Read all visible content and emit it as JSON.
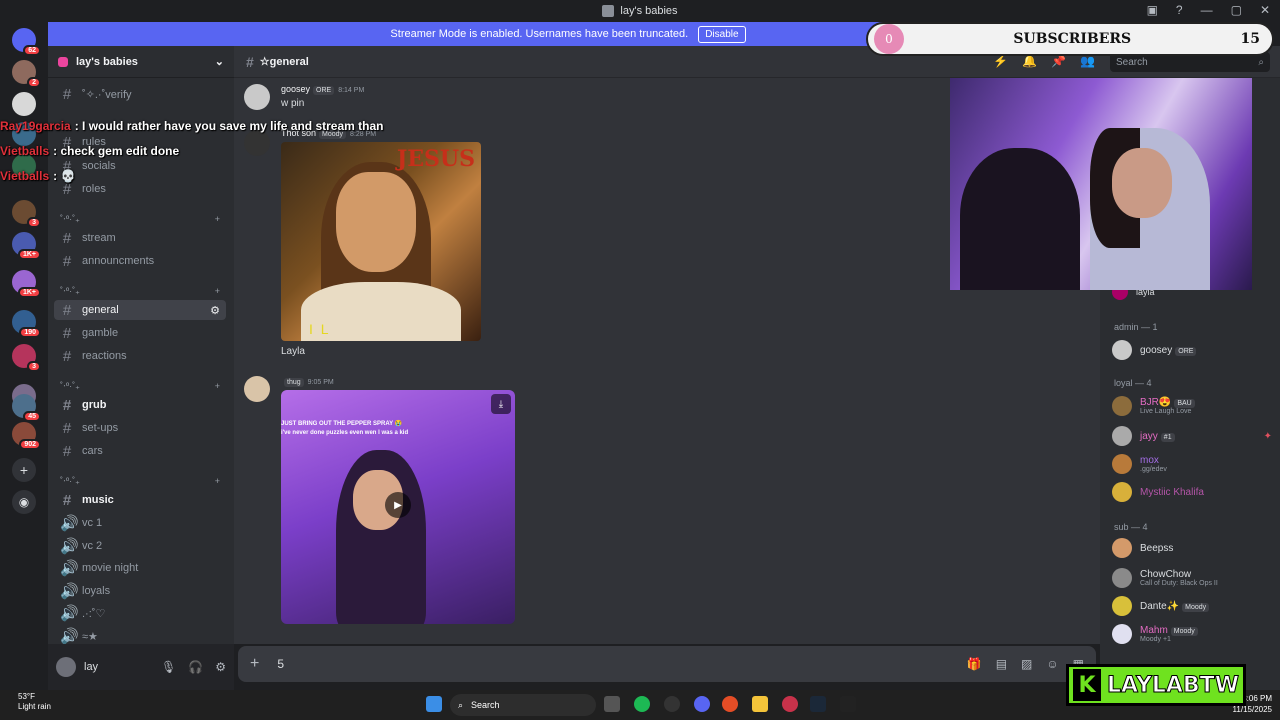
{
  "window": {
    "title": "lay's babies"
  },
  "banner": {
    "text": "Streamer Mode is enabled. Usernames have been truncated.",
    "button": "Disable"
  },
  "server_badges": [
    "62",
    "2",
    "3",
    "1K+",
    "1K+",
    "190",
    "3",
    "45",
    "902"
  ],
  "server": {
    "name": "lay's babies"
  },
  "channels": [
    {
      "label": "˚✧.·˚verify"
    },
    {
      "label": "rules"
    },
    {
      "label": "socials"
    },
    {
      "label": "roles"
    },
    {
      "label": "stream"
    },
    {
      "label": "announcments"
    },
    {
      "label": "general"
    },
    {
      "label": "gamble"
    },
    {
      "label": "reactions"
    },
    {
      "label": "grub"
    },
    {
      "label": "set-ups"
    },
    {
      "label": "cars"
    },
    {
      "label": "music"
    },
    {
      "label": "vc 1"
    },
    {
      "label": "vc 2"
    },
    {
      "label": "movie night"
    },
    {
      "label": "loyals"
    },
    {
      "label": ".·:˚♡"
    },
    {
      "label": "≈★"
    }
  ],
  "categories": [
    "˚‧º·˚₊",
    "˚‧º·˚₊",
    "˚‧º·˚₊",
    "˚‧º·˚₊"
  ],
  "user": {
    "name": "lay"
  },
  "chat_header": {
    "channel": "☆general",
    "search_placeholder": "Search"
  },
  "messages": [
    {
      "author": "goosey",
      "tag": "ORE",
      "time": "8:14 PM",
      "text": "w pin"
    },
    {
      "author": "Thot son",
      "tag": "Moody",
      "time": "8:28 PM",
      "image_text": "JESUS",
      "image_sub": "I L",
      "caption": "Layla"
    },
    {
      "author": "",
      "tag": "thug",
      "time": "9:05 PM",
      "video_caption_1": "JUST BRING OUT THE PEPPER SPRAY 😭",
      "video_caption_2": "i've never done puzzles even wen I was a kid"
    }
  ],
  "composer": {
    "value": "5"
  },
  "members": {
    "groups": [
      {
        "label": "admin — 1",
        "items": [
          {
            "name": "goosey",
            "tag": "ORE"
          }
        ]
      },
      {
        "label": "loyal — 4",
        "items": [
          {
            "name": "BJR😍",
            "tag": "BAU",
            "status": "Live Laugh Love"
          },
          {
            "name": "jayy",
            "tag": "#1"
          },
          {
            "name": "mox",
            "status": ".gg/edev"
          },
          {
            "name": "Mystiic Khalifa"
          }
        ]
      },
      {
        "label": "sub — 4",
        "items": [
          {
            "name": "Beepss"
          },
          {
            "name": "ChowChow",
            "status": "Call of Duty: Black Ops II"
          },
          {
            "name": "Dante✨",
            "tag": "Moody"
          },
          {
            "name": "Mahm",
            "tag": "Moody",
            "status": "Moody +1"
          }
        ]
      }
    ],
    "top_member": "layla"
  },
  "overlay": {
    "sub_count_left": "0",
    "sub_label": "SUBSCRIBERS",
    "sub_goal": "15",
    "brand": "LAYLABTW"
  },
  "stream_chat": [
    {
      "user": "Ray19garcia",
      "text": ": I would rather have you save my life and stream than"
    },
    {
      "user": "Vietballs",
      "text": ": check gem edit done"
    },
    {
      "user": "Vietballs",
      "text": ": 💀"
    }
  ],
  "taskbar": {
    "temp": "53°F",
    "weather": "Light rain",
    "search": "Search",
    "time": "8:06 PM",
    "date": "11/15/2025"
  },
  "colors": {
    "accent": "#5865f2",
    "brand_green": "#6fe21f",
    "sub_pink": "#e68ab6"
  }
}
